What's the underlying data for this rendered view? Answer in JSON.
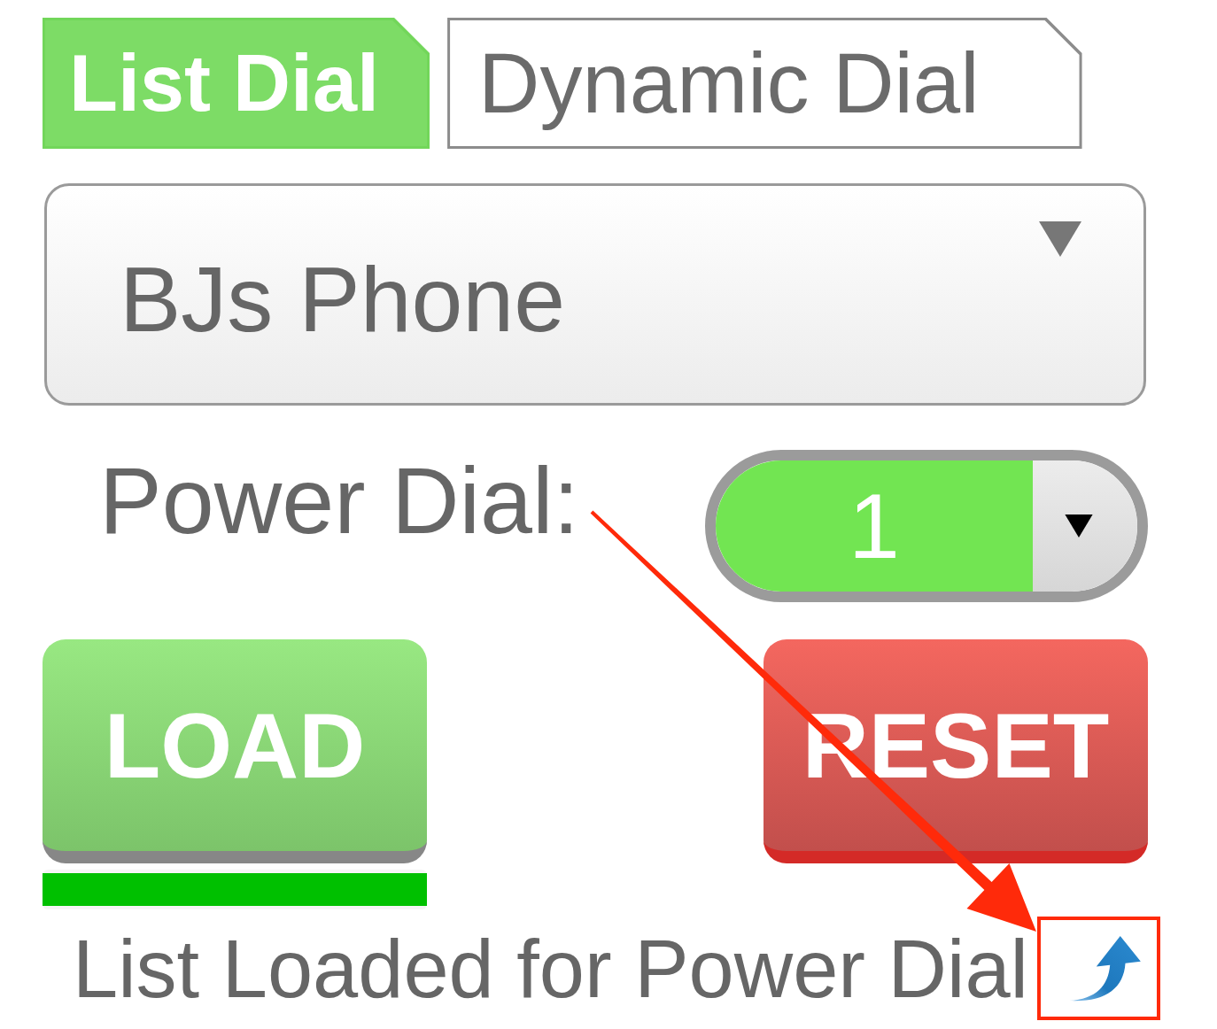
{
  "tabs": [
    {
      "label": "List Dial",
      "selected": true
    },
    {
      "label": "Dynamic Dial",
      "selected": false
    }
  ],
  "list_select": {
    "value": "BJs Phone"
  },
  "power_dial": {
    "label": "Power Dial:",
    "value": "1"
  },
  "buttons": [
    {
      "label": "LOAD",
      "kind": "load"
    },
    {
      "label": "RESET",
      "kind": "reset"
    }
  ],
  "progress": {
    "level": 1
  },
  "status": {
    "text": "List Loaded for Power Dial"
  }
}
